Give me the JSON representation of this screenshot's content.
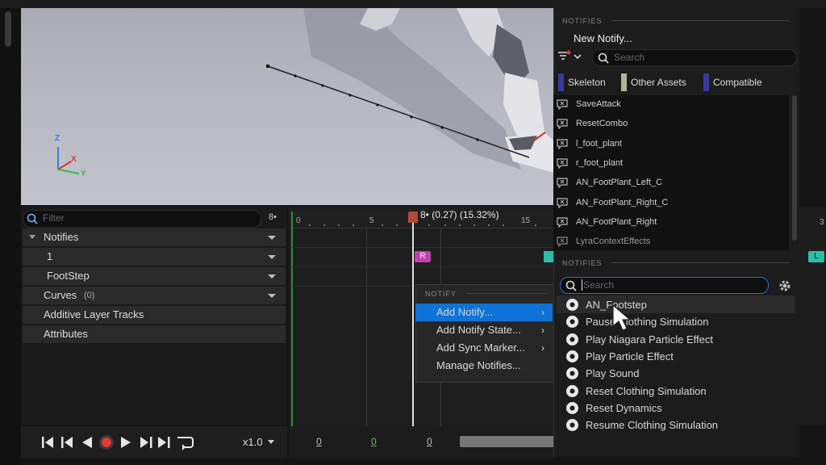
{
  "viewport": {
    "axis_x": "X",
    "axis_y": "Y",
    "axis_z": "Z"
  },
  "left_panel": {
    "filter_placeholder": "Filter",
    "filter_count": "8•",
    "rows": [
      {
        "label": "Notifies",
        "dropdown": true
      },
      {
        "label": "1",
        "dropdown": true
      },
      {
        "label": "FootStep",
        "dropdown": true
      },
      {
        "label": "Curves",
        "count": "(0)",
        "dropdown": true
      },
      {
        "label": "Additive Layer Tracks",
        "dropdown": false
      },
      {
        "label": "Attributes",
        "dropdown": false
      }
    ]
  },
  "timeline": {
    "playhead_label": "8• (0.27) (15.32%)",
    "ticks": [
      "0",
      "5",
      "15"
    ],
    "marker_r": "R",
    "marker_l": "L",
    "right_tick": "3"
  },
  "transport": {
    "speed": "x1.0",
    "frame_values": [
      "0",
      "0",
      "0"
    ]
  },
  "context_menu": {
    "header": "NOTIFY",
    "items": [
      {
        "label": "Add Notify...",
        "submenu": true,
        "highlighted": true
      },
      {
        "label": "Add Notify State...",
        "submenu": true,
        "highlighted": false
      },
      {
        "label": "Add Sync Marker...",
        "submenu": true,
        "highlighted": false
      },
      {
        "label": "Manage Notifies...",
        "submenu": false,
        "highlighted": false
      }
    ]
  },
  "notify_panel": {
    "header": "NOTIFIES",
    "new_notify": "New Notify...",
    "search_placeholder": "Search",
    "filters": [
      {
        "label": "Skeleton",
        "color": "#3a3a9a"
      },
      {
        "label": "Other Assets",
        "color": "#b4b49a"
      },
      {
        "label": "Compatible",
        "color": "#3a3a9a"
      }
    ],
    "list": [
      "SaveAttack",
      "ResetCombo",
      "l_foot_plant",
      "r_foot_plant",
      "AN_FootPlant_Left_C",
      "AN_FootPlant_Right_C",
      "AN_FootPlant_Right",
      "LyraContextEffects"
    ]
  },
  "notify_search": {
    "header": "NOTIFIES",
    "search_placeholder": "Search",
    "results": [
      "AN_Footstep",
      "Pause Clothing Simulation",
      "Play Niagara Particle Effect",
      "Play Particle Effect",
      "Play Sound",
      "Reset Clothing Simulation",
      "Reset Dynamics",
      "Resume Clothing Simulation"
    ]
  },
  "colors": {
    "menu_highlight": "#0e72d6",
    "accent_blue": "#2a6fd8",
    "marker_purple": "#c040b0",
    "marker_teal": "#2bbfa8",
    "playhead": "#b04b3c"
  }
}
